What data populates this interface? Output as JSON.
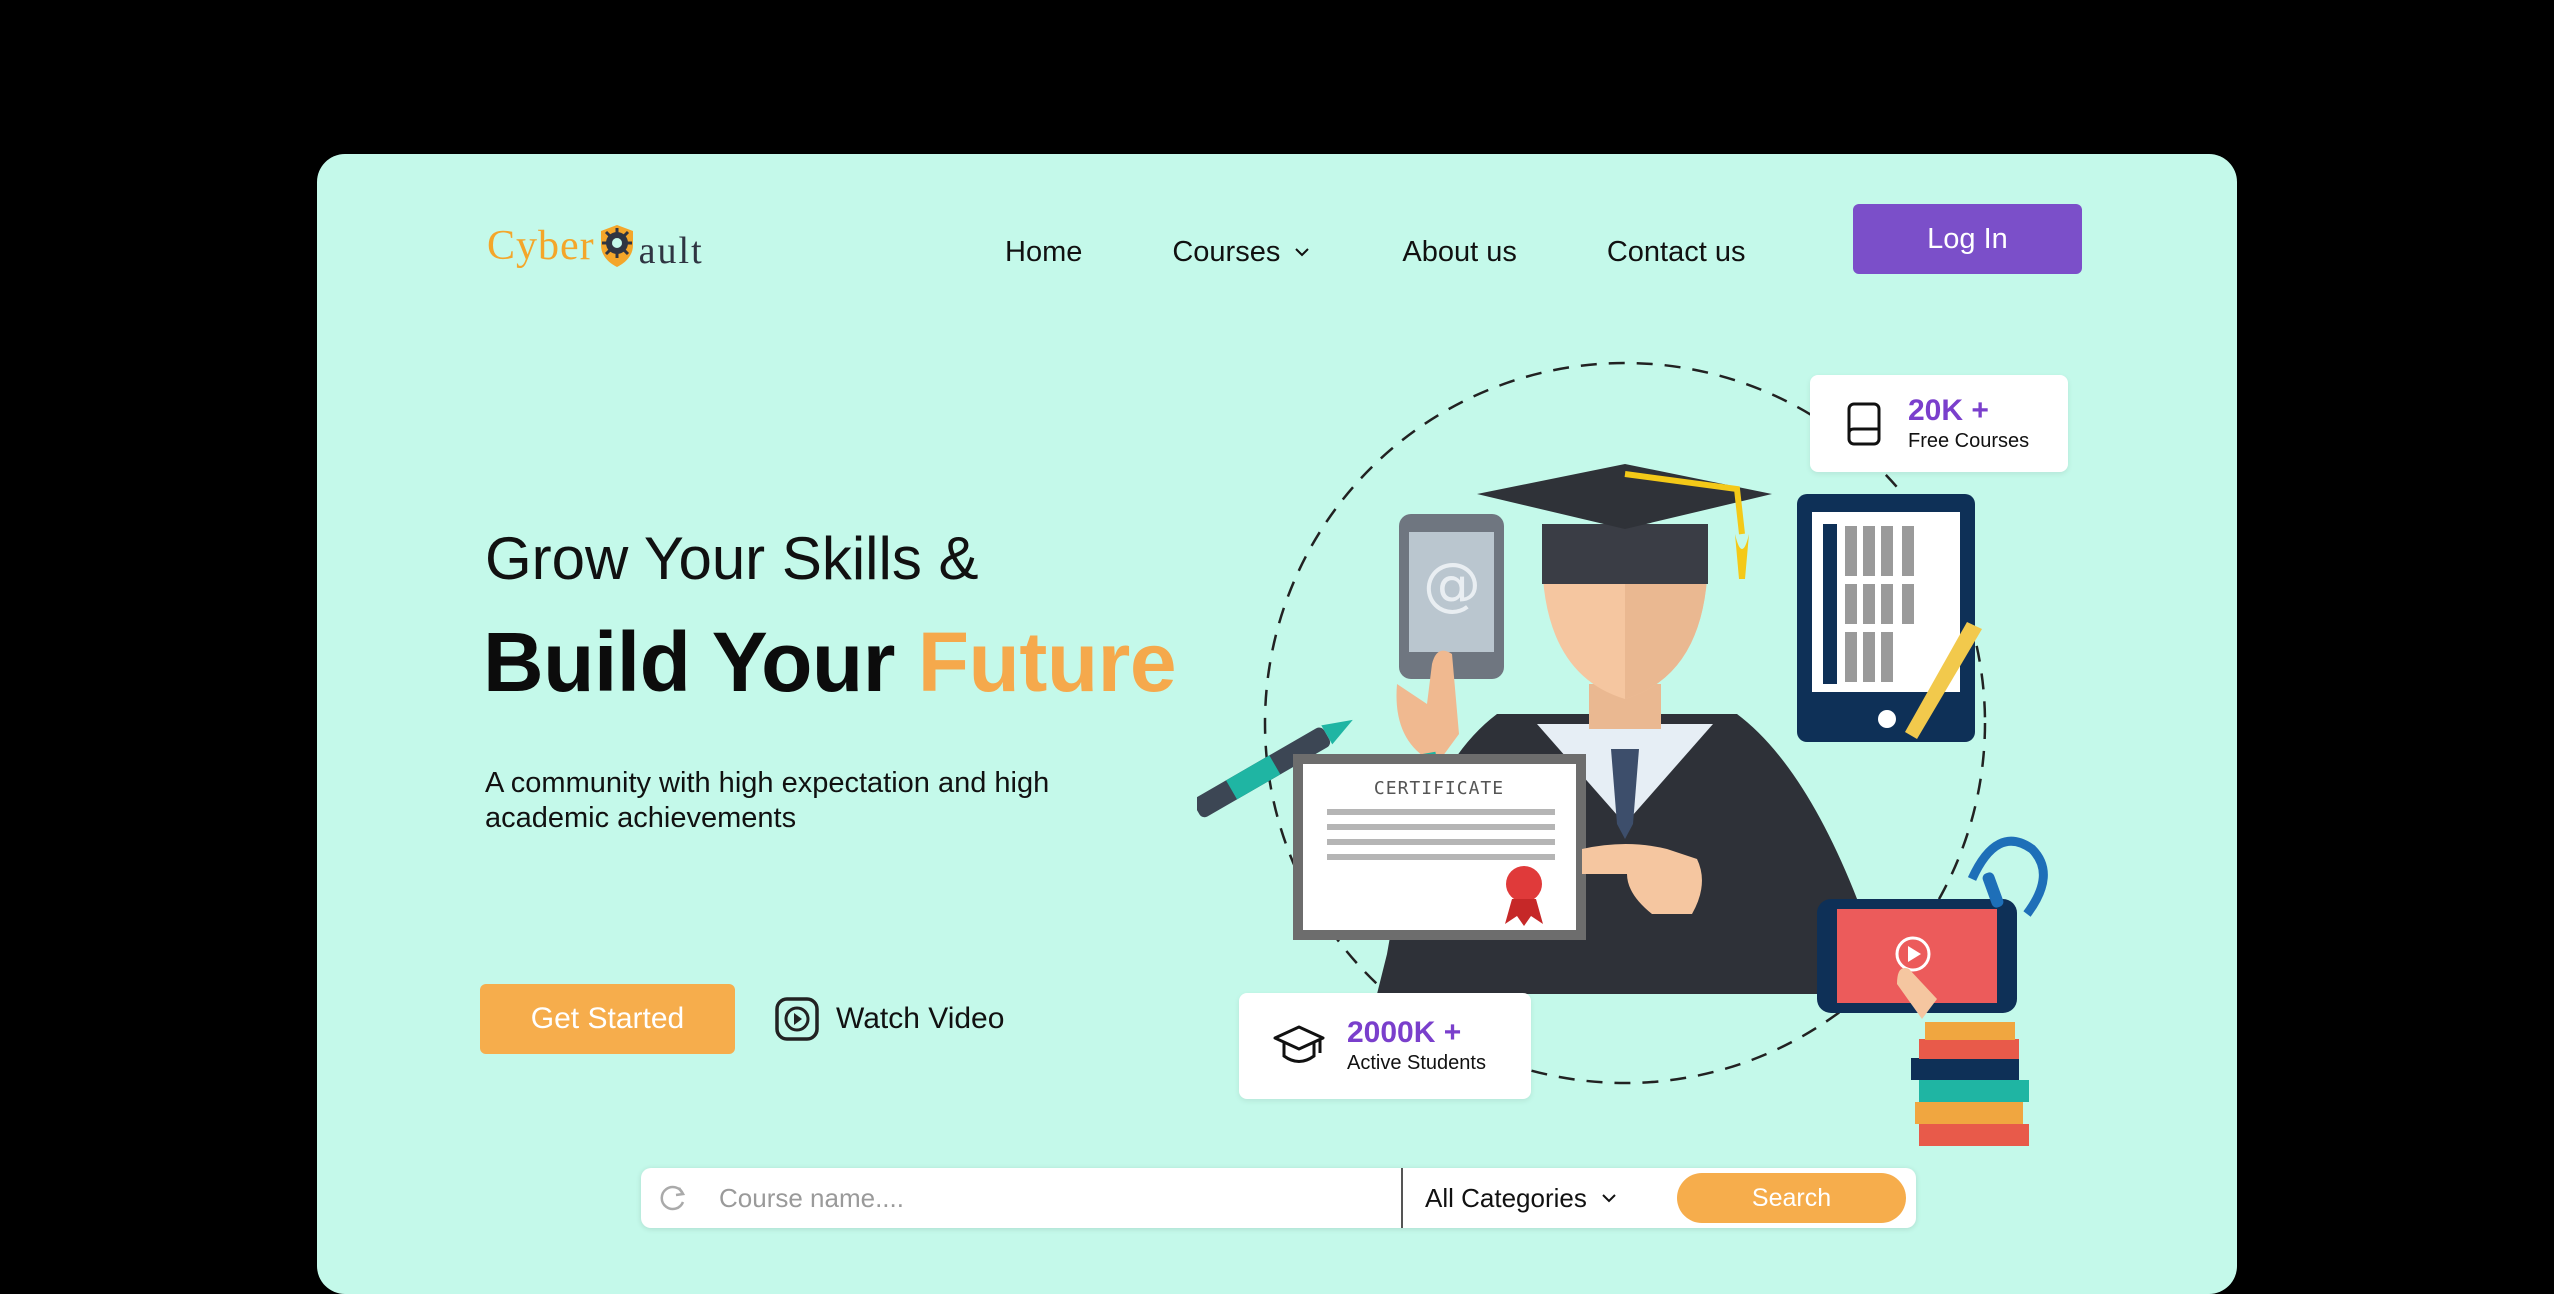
{
  "brand": {
    "name_part1": "Cyber",
    "name_part2": "ault",
    "color_primary": "#f4a62a",
    "color_dark": "#2f3542"
  },
  "nav": {
    "items": [
      {
        "label": "Home"
      },
      {
        "label": "Courses"
      },
      {
        "label": "About us"
      },
      {
        "label": "Contact us"
      }
    ],
    "login_label": "Log In"
  },
  "hero": {
    "line1": "Grow Your Skills &",
    "line2_prefix": "Build Your",
    "line2_accent": "Future",
    "description": "A community with high expectation and high academic achievements",
    "cta_primary": "Get Started",
    "cta_secondary": "Watch Video"
  },
  "stats": [
    {
      "value": "20K +",
      "label": "Free Courses",
      "icon": "book-icon"
    },
    {
      "value": "2000K +",
      "label": "Active Students",
      "icon": "graduation-cap-icon"
    }
  ],
  "illustration": {
    "certificate_text": "CERTIFICATE"
  },
  "search": {
    "placeholder": "Course name....",
    "category_label": "All Categories",
    "button_label": "Search"
  },
  "colors": {
    "background": "#c4f9ea",
    "accent_orange": "#f6ad4c",
    "accent_purple": "#7b4fc9"
  }
}
